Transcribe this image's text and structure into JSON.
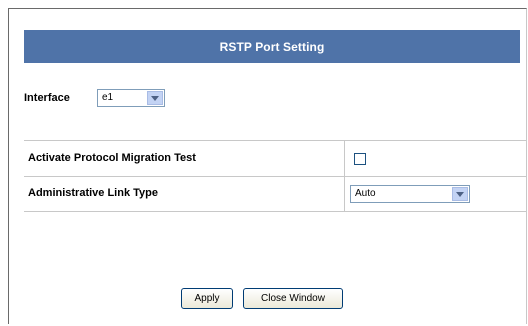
{
  "header": {
    "title": "RSTP Port Setting"
  },
  "interface": {
    "label": "Interface",
    "selected": "e1"
  },
  "table": {
    "rows": [
      {
        "label": "Activate Protocol Migration Test",
        "checked": false
      },
      {
        "label": "Administrative Link Type",
        "selected": "Auto"
      }
    ]
  },
  "buttons": {
    "apply": "Apply",
    "close": "Close Window"
  }
}
